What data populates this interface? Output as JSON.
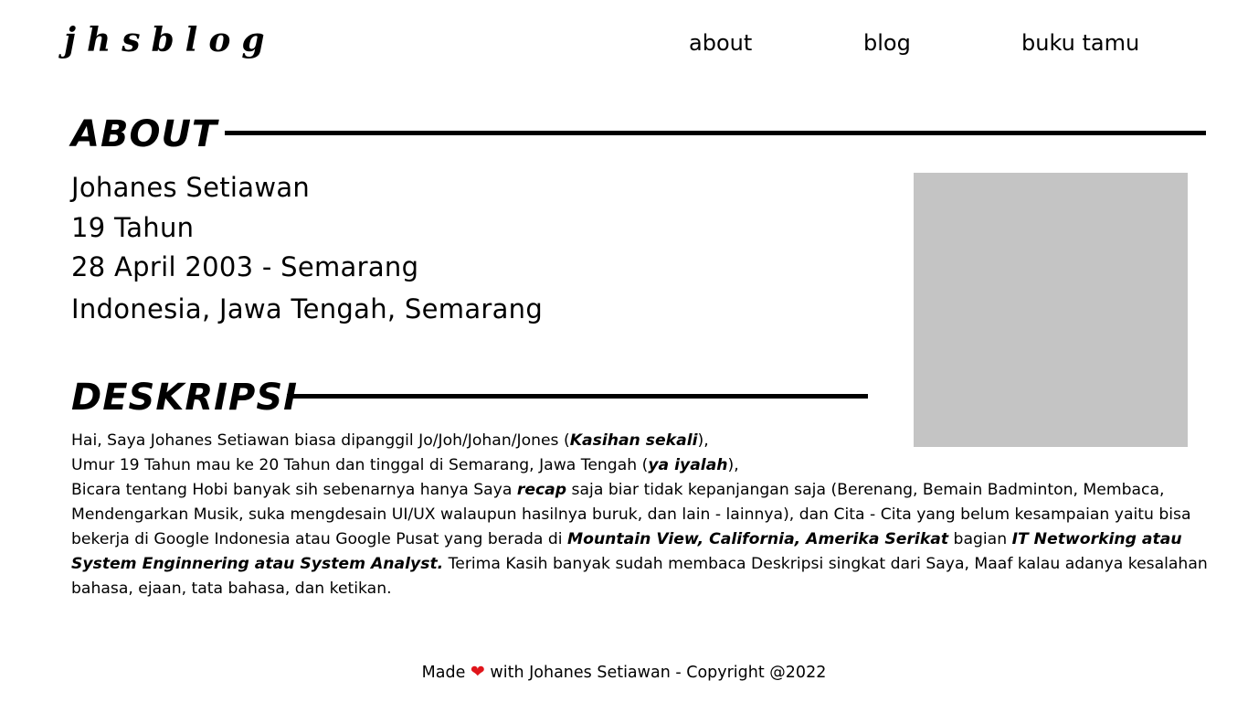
{
  "header": {
    "logo": "jhsblog",
    "nav": [
      {
        "label": "about"
      },
      {
        "label": "blog"
      },
      {
        "label": "buku tamu"
      }
    ]
  },
  "about": {
    "title": "ABOUT",
    "info": [
      "Johanes Setiawan",
      "19 Tahun",
      "28 April 2003 - Semarang",
      "Indonesia, Jawa Tengah, Semarang"
    ],
    "photo_color": "#c4c4c4"
  },
  "deskripsi": {
    "title": "DESKRIPSI",
    "line1_pre": "Hai, Saya Johanes Setiawan biasa dipanggil Jo/Joh/Johan/Jones (",
    "line1_em": "Kasihan sekali",
    "line1_post": "),",
    "line2_pre": "Umur 19 Tahun mau ke 20 Tahun dan tinggal di Semarang, Jawa Tengah (",
    "line2_em": "ya iyalah",
    "line2_post": "),",
    "para_a": "Bicara tentang Hobi banyak sih sebenarnya hanya Saya ",
    "para_em1": "recap",
    "para_b": " saja biar tidak kepanjangan saja (Berenang, Bemain Badminton, Membaca, Mendengarkan Musik, suka mengdesain UI/UX walaupun hasilnya buruk, dan lain - lainnya), dan Cita - Cita yang belum kesampaian yaitu bisa bekerja di Google Indonesia atau Google Pusat yang berada di ",
    "para_em2": "Mountain View, California, Amerika Serikat",
    "para_c": " bagian ",
    "para_em3": "IT Networking atau System Enginnering atau System Analyst.",
    "para_d": " Terima Kasih banyak sudah membaca Deskripsi singkat dari Saya, Maaf kalau adanya kesalahan bahasa, ejaan, tata bahasa, dan ketikan."
  },
  "footer": {
    "made": "Made",
    "heart_icon": "heart-icon",
    "rest": "with Johanes Setiawan - Copyright @2022",
    "heart_color": "#e0151b"
  }
}
